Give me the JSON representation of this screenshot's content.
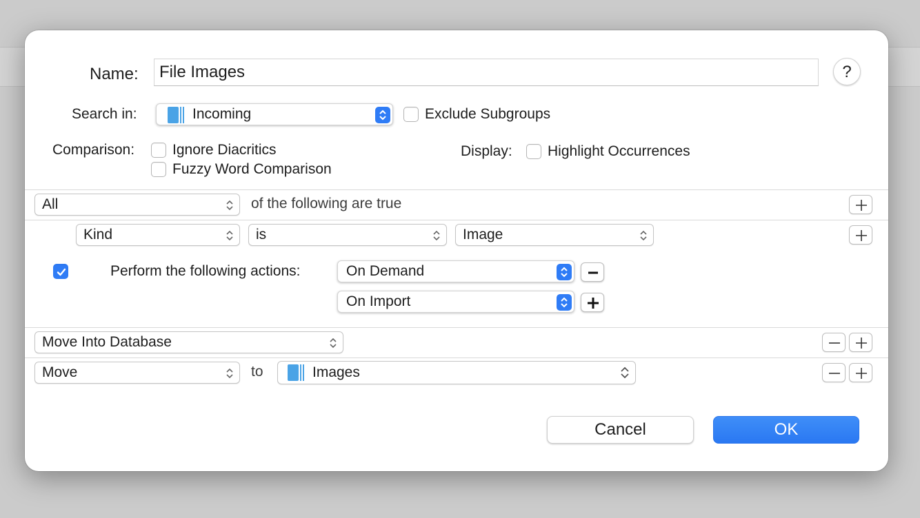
{
  "dialog": {
    "name_label": "Name:",
    "name_value": "File Images",
    "help_label": "?",
    "search_in_label": "Search in:",
    "search_in_value": "Incoming",
    "exclude_subgroups_label": "Exclude Subgroups",
    "exclude_subgroups_checked": false,
    "comparison_label": "Comparison:",
    "ignore_diacritics_label": "Ignore Diacritics",
    "fuzzy_word_label": "Fuzzy Word Comparison",
    "display_label": "Display:",
    "highlight_label": "Highlight Occurrences"
  },
  "criteria": {
    "match_value": "All",
    "match_suffix": "of the following are true",
    "rule": {
      "field": "Kind",
      "operator": "is",
      "value": "Image"
    }
  },
  "actions": {
    "perform_checked": true,
    "perform_label": "Perform the following actions:",
    "triggers": [
      "On Demand",
      "On Import"
    ],
    "action1": "Move Into Database",
    "action2_verb": "Move",
    "action2_to": "to",
    "action2_target": "Images"
  },
  "buttons": {
    "cancel": "Cancel",
    "ok": "OK"
  },
  "colors": {
    "accent": "#2f7cf6",
    "db_icon": "#4aa3e6"
  }
}
